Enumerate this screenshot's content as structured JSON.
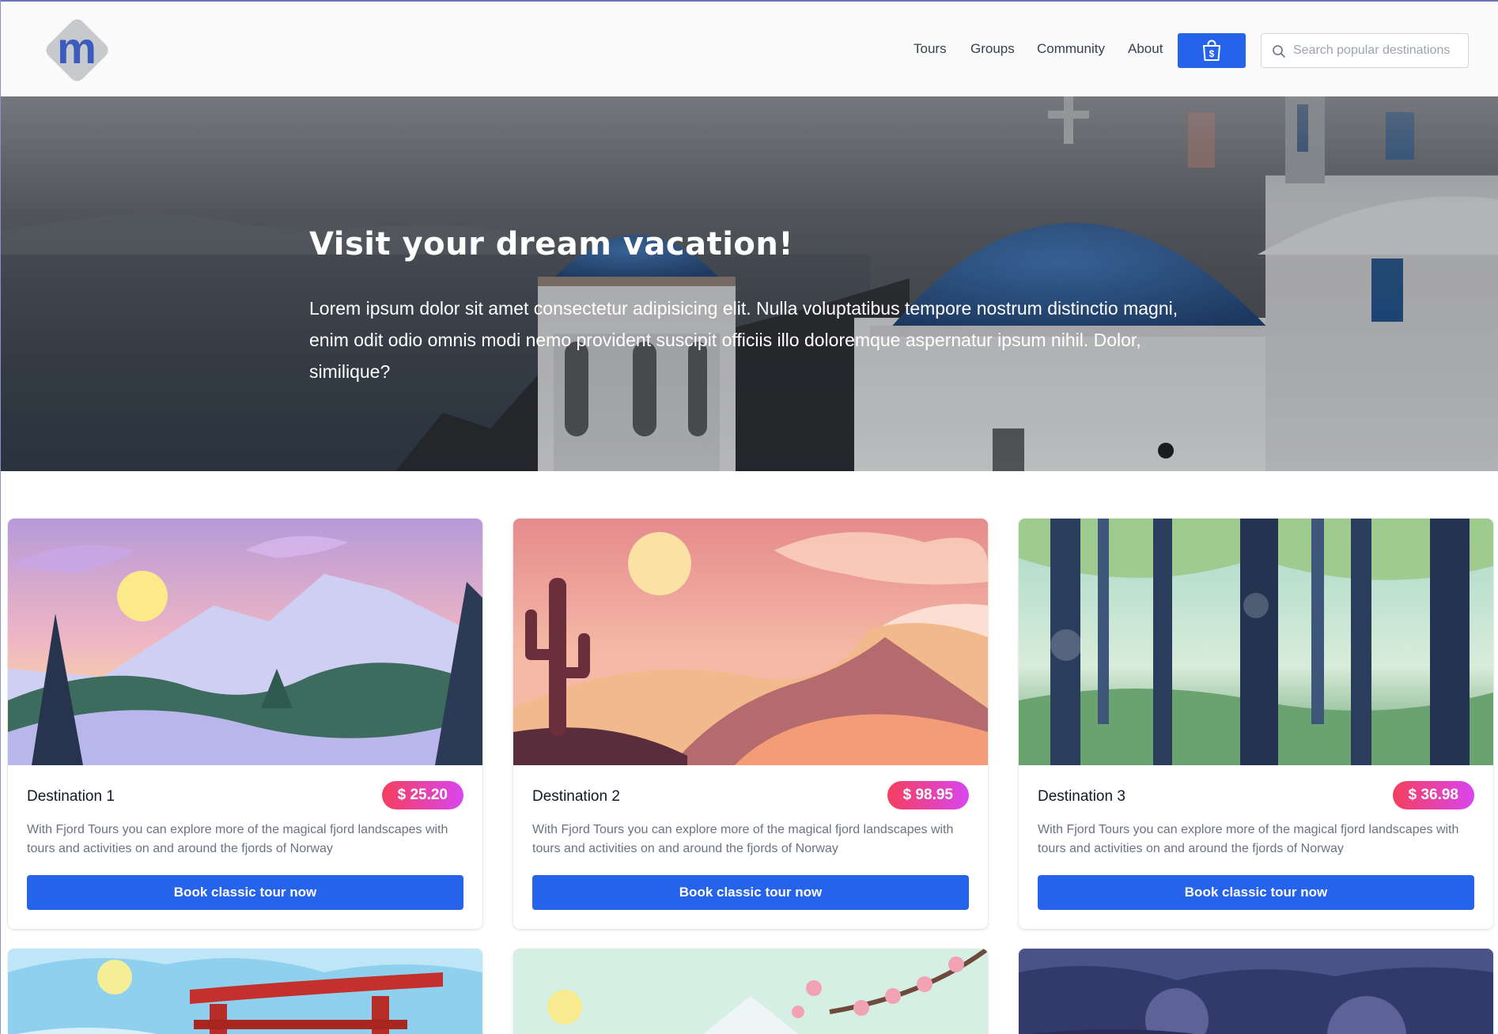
{
  "header": {
    "logo_letter": "m",
    "nav": [
      "Tours",
      "Groups",
      "Community",
      "About"
    ],
    "cart_icon": "shopping-bag-dollar-icon",
    "search": {
      "placeholder": "Search popular destinations",
      "value": ""
    }
  },
  "hero": {
    "title": "Visit your dream vacation!",
    "text": "Lorem ipsum dolor sit amet consectetur adipisicing elit. Nulla voluptatibus tempore nostrum distinctio magni, enim odit odio omnis modi nemo provident suscipit officiis illo doloremque aspernatur ipsum nihil. Dolor, similique?"
  },
  "cards": [
    {
      "title": "Destination 1",
      "price": "$ 25.20",
      "description": "With Fjord Tours you can explore more of the magical fjord landscapes with tours and activities on and around the fjords of Norway",
      "button": "Book classic tour now"
    },
    {
      "title": "Destination 2",
      "price": "$ 98.95",
      "description": "With Fjord Tours you can explore more of the magical fjord landscapes with tours and activities on and around the fjords of Norway",
      "button": "Book classic tour now"
    },
    {
      "title": "Destination 3",
      "price": "$ 36.98",
      "description": "With Fjord Tours you can explore more of the magical fjord landscapes with tours and activities on and around the fjords of Norway",
      "button": "Book classic tour now"
    }
  ],
  "colors": {
    "primary": "#2563eb",
    "price_from": "#f43f5e",
    "price_to": "#d946ef"
  }
}
